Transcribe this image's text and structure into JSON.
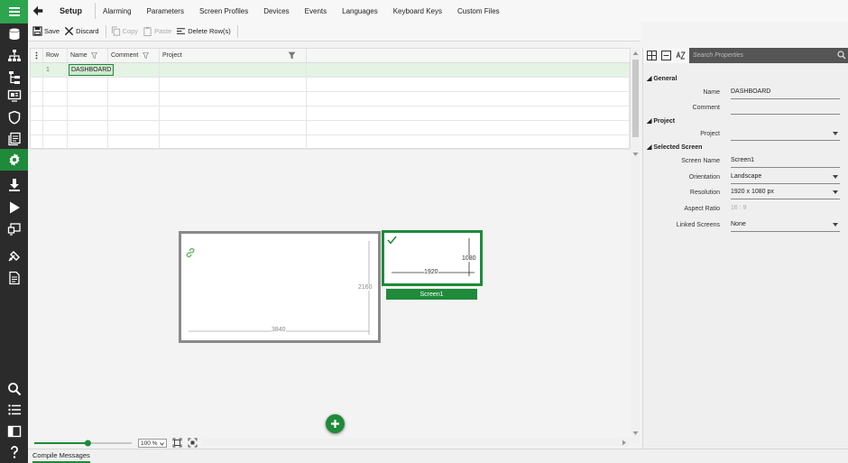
{
  "nav": {
    "title": "Setup",
    "tabs": [
      {
        "label": "Alarming"
      },
      {
        "label": "Parameters"
      },
      {
        "label": "Screen Profiles"
      },
      {
        "label": "Devices"
      },
      {
        "label": "Events"
      },
      {
        "label": "Languages"
      },
      {
        "label": "Keyboard Keys"
      },
      {
        "label": "Custom Files"
      }
    ],
    "active_tab": "Screen Profiles"
  },
  "toolbar": {
    "save": "Save",
    "discard": "Discard",
    "copy": "Copy",
    "paste": "Paste",
    "delete_rows": "Delete Row(s)"
  },
  "grid": {
    "columns": [
      "Row",
      "Name",
      "Comment",
      "Project"
    ],
    "rows": [
      {
        "row": "1",
        "name": "DASHBOARD",
        "comment": "",
        "project": ""
      }
    ]
  },
  "canvas": {
    "screen_a": {
      "width_label": "3840",
      "height_label": "2160"
    },
    "screen_b": {
      "width_label": "1920",
      "height_label": "1080",
      "name": "Screen1"
    }
  },
  "zoom": {
    "value": "100 %",
    "level": 0.55
  },
  "bottom_tab": "Compile Messages",
  "properties": {
    "search_placeholder": "Search Properties",
    "sections": {
      "general": "General",
      "project": "Project",
      "selected_screen": "Selected Screen"
    },
    "fields": {
      "name": {
        "label": "Name",
        "value": "DASHBOARD"
      },
      "comment": {
        "label": "Comment",
        "value": ""
      },
      "project": {
        "label": "Project",
        "value": ""
      },
      "screen_name": {
        "label": "Screen Name",
        "value": "Screen1"
      },
      "orientation": {
        "label": "Orientation",
        "value": "Landscape"
      },
      "resolution": {
        "label": "Resolution",
        "value": "1920 x 1080 px"
      },
      "aspect_ratio": {
        "label": "Aspect Ratio",
        "value": "16 : 9"
      },
      "linked_screens": {
        "label": "Linked Screens",
        "value": "None"
      }
    }
  },
  "colors": {
    "accent": "#1f8a3a",
    "rail": "#2b2b2b"
  }
}
